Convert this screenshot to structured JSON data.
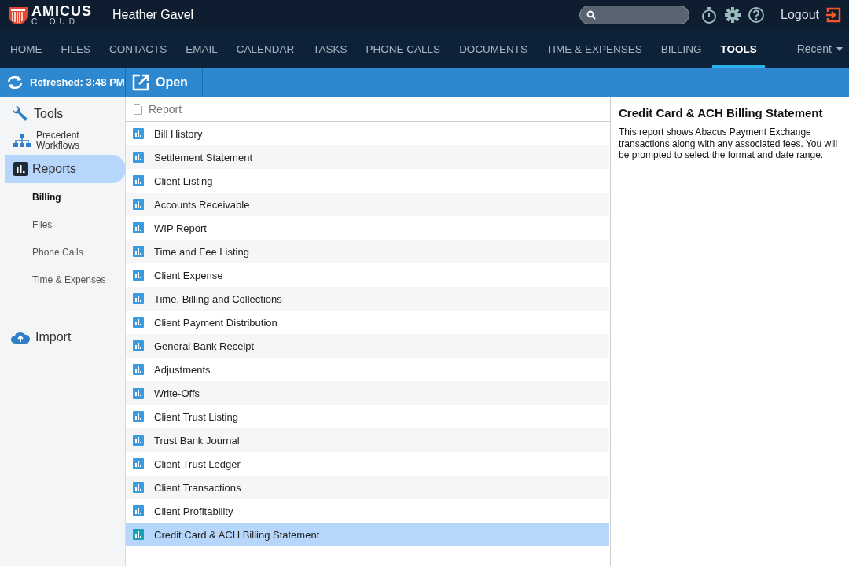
{
  "header": {
    "logo_top": "AMICUS",
    "logo_bottom": "CLOUD",
    "user": "Heather Gavel",
    "logout": "Logout"
  },
  "nav": {
    "tabs": [
      {
        "label": "HOME",
        "selected": false
      },
      {
        "label": "FILES",
        "selected": false
      },
      {
        "label": "CONTACTS",
        "selected": false
      },
      {
        "label": "EMAIL",
        "selected": false
      },
      {
        "label": "CALENDAR",
        "selected": false
      },
      {
        "label": "TASKS",
        "selected": false
      },
      {
        "label": "PHONE CALLS",
        "selected": false
      },
      {
        "label": "DOCUMENTS",
        "selected": false
      },
      {
        "label": "TIME & EXPENSES",
        "selected": false
      },
      {
        "label": "BILLING",
        "selected": false
      },
      {
        "label": "TOOLS",
        "selected": true
      }
    ],
    "recent": "Recent"
  },
  "toolbar": {
    "refreshed": "Refreshed: 3:48 PM",
    "open": "Open"
  },
  "sidebar": {
    "items": [
      {
        "kind": "tools",
        "label": "Tools",
        "selected": false
      },
      {
        "kind": "workflows",
        "label": "Precedent Workflows",
        "selected": false
      },
      {
        "kind": "reports",
        "label": "Reports",
        "selected": true,
        "children": [
          {
            "label": "Billing",
            "selected": true
          },
          {
            "label": "Files",
            "selected": false
          },
          {
            "label": "Phone Calls",
            "selected": false
          },
          {
            "label": "Time & Expenses",
            "selected": false
          }
        ]
      },
      {
        "kind": "import",
        "label": "Import",
        "selected": false
      }
    ]
  },
  "report_list": {
    "column": "Report",
    "rows": [
      {
        "name": "Bill History",
        "selected": false
      },
      {
        "name": "Settlement Statement",
        "selected": false
      },
      {
        "name": "Client Listing",
        "selected": false
      },
      {
        "name": "Accounts Receivable",
        "selected": false
      },
      {
        "name": "WIP Report",
        "selected": false
      },
      {
        "name": "Time and Fee Listing",
        "selected": false
      },
      {
        "name": "Client Expense",
        "selected": false
      },
      {
        "name": "Time, Billing and Collections",
        "selected": false
      },
      {
        "name": "Client Payment Distribution",
        "selected": false
      },
      {
        "name": "General Bank Receipt",
        "selected": false
      },
      {
        "name": "Adjustments",
        "selected": false
      },
      {
        "name": "Write-Offs",
        "selected": false
      },
      {
        "name": "Client Trust Listing",
        "selected": false
      },
      {
        "name": "Trust Bank Journal",
        "selected": false
      },
      {
        "name": "Client Trust Ledger",
        "selected": false
      },
      {
        "name": "Client Transactions",
        "selected": false
      },
      {
        "name": "Client Profitability",
        "selected": false
      },
      {
        "name": "Credit Card & ACH Billing Statement",
        "selected": true
      }
    ]
  },
  "detail": {
    "title": "Credit Card & ACH Billing Statement",
    "description": "This report shows Abacus Payment Exchange transactions along with any associated fees. You will be prompted to select the format and date range."
  }
}
